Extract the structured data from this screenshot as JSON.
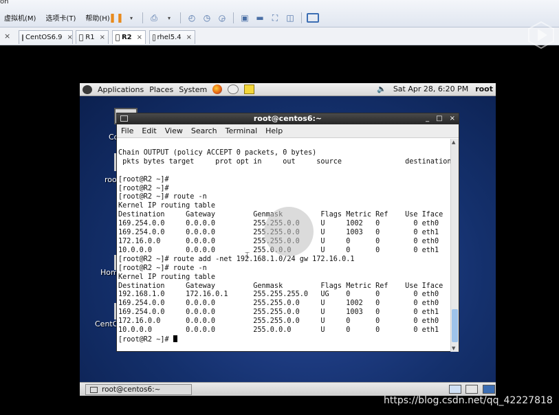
{
  "vm": {
    "corner_text": "on",
    "menus": [
      "虚拟机(M)",
      "选项卡(T)",
      "帮助(H)"
    ],
    "tool_icons": [
      "pause-icon",
      "send-keys-icon",
      "snapshot-icon",
      "revert-snapshot-icon",
      "manage-snapshots-icon",
      "console-view-icon",
      "quick-switch-icon",
      "fullscreen-icon",
      "unity-icon",
      "thumbnail-icon"
    ],
    "tabs": [
      {
        "label": "CentOS6.9",
        "active": false
      },
      {
        "label": "R1",
        "active": false
      },
      {
        "label": "R2",
        "active": true
      },
      {
        "label": "rhel5.4",
        "active": false
      }
    ],
    "tab_close": "×"
  },
  "gnome": {
    "menus": [
      "Applications",
      "Places",
      "System"
    ],
    "datetime": "Sat Apr 28,  6:20 PM",
    "user": "root",
    "desktop_labels": [
      "Co",
      "roo",
      "Hom",
      "CentO"
    ],
    "taskbar_item": "root@centos6:~"
  },
  "terminal": {
    "title": "root@centos6:~",
    "menu": [
      "File",
      "Edit",
      "View",
      "Search",
      "Terminal",
      "Help"
    ],
    "lines": [
      "",
      "Chain OUTPUT (policy ACCEPT 0 packets, 0 bytes)",
      " pkts bytes target     prot opt in     out     source               destination",
      "",
      "[root@R2 ~]#",
      "[root@R2 ~]#",
      "[root@R2 ~]# route -n",
      "Kernel IP routing table",
      "Destination     Gateway         Genmask         Flags Metric Ref    Use Iface",
      "169.254.0.0     0.0.0.0         255.255.0.0     U     1002   0        0 eth0",
      "169.254.0.0     0.0.0.0         255.255.0.0     U     1003   0        0 eth1",
      "172.16.0.0      0.0.0.0         255.255.0.0     U     0      0        0 eth0",
      "10.0.0.0        0.0.0.0         255.0.0.0       U     0      0        0 eth1",
      "[root@R2 ~]# route add -net 192.168.1.0/24 gw 172.16.0.1",
      "[root@R2 ~]# route -n",
      "Kernel IP routing table",
      "Destination     Gateway         Genmask         Flags Metric Ref    Use Iface",
      "192.168.1.0     172.16.0.1      255.255.255.0   UG    0      0        0 eth0",
      "169.254.0.0     0.0.0.0         255.255.0.0     U     1002   0        0 eth0",
      "169.254.0.0     0.0.0.0         255.255.0.0     U     1003   0        0 eth1",
      "172.16.0.0      0.0.0.0         255.255.0.0     U     0      0        0 eth0",
      "10.0.0.0        0.0.0.0         255.0.0.0       U     0      0        0 eth1"
    ],
    "prompt": "[root@R2 ~]# ",
    "buttons": {
      "minimize": "_",
      "maximize": "□",
      "close": "×"
    }
  },
  "watermark": "https://blog.csdn.net/qq_42227818"
}
